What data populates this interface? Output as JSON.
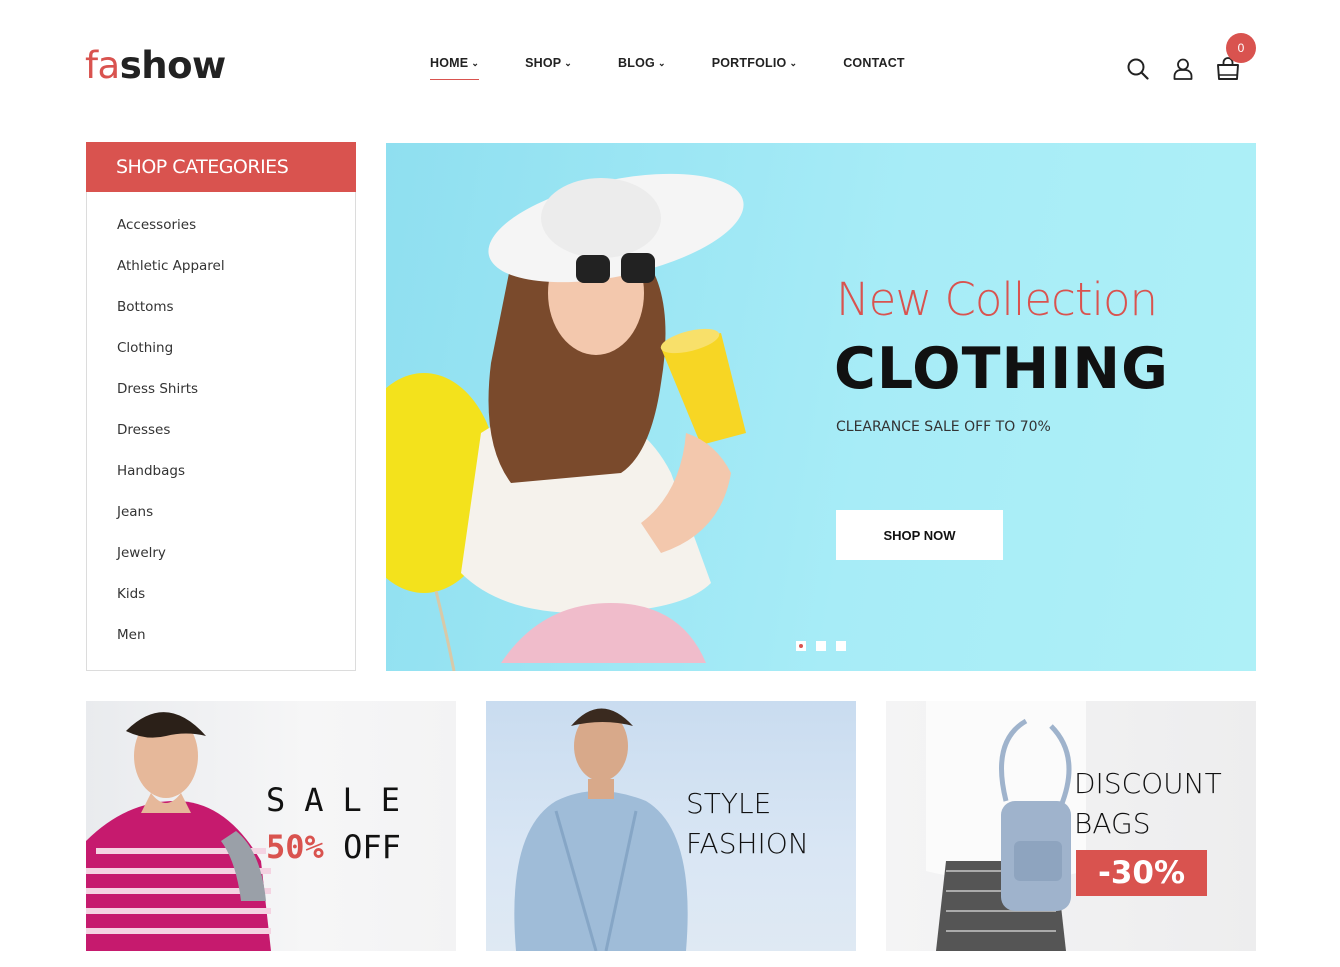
{
  "brand": {
    "logo_part1": "fa",
    "logo_part2": "show"
  },
  "nav": {
    "items": [
      {
        "label": "HOME",
        "has_dropdown": true,
        "active": true
      },
      {
        "label": "SHOP",
        "has_dropdown": true,
        "active": false
      },
      {
        "label": "BLOG",
        "has_dropdown": true,
        "active": false
      },
      {
        "label": "PORTFOLIO",
        "has_dropdown": true,
        "active": false
      },
      {
        "label": "CONTACT",
        "has_dropdown": false,
        "active": false
      }
    ]
  },
  "header_icons": {
    "search": "search-icon",
    "account": "user-icon",
    "cart": "shopping-bag-icon",
    "cart_count": "0"
  },
  "sidebar": {
    "title": "SHOP CATEGORIES",
    "items": [
      "Accessories",
      "Athletic Apparel",
      "Bottoms",
      "Clothing",
      "Dress Shirts",
      "Dresses",
      "Handbags",
      "Jeans",
      "Jewelry",
      "Kids",
      "Men"
    ]
  },
  "hero": {
    "subtitle": "New Collection",
    "title": "CLOTHING",
    "description": "CLEARANCE SALE OFF TO 70%",
    "button_label": "SHOP NOW",
    "slide_count": 3,
    "active_slide": 1
  },
  "banners": {
    "sale": {
      "line1": "SALE",
      "percent": "50%",
      "off": "OFF"
    },
    "style": {
      "line1": "STYLE",
      "line2": "FASHION"
    },
    "discount": {
      "line1": "DISCOUNT",
      "line2": "BAGS",
      "tag": "-30%"
    }
  },
  "colors": {
    "accent": "#d9534f",
    "hero_bg": "#a7ecf7"
  }
}
